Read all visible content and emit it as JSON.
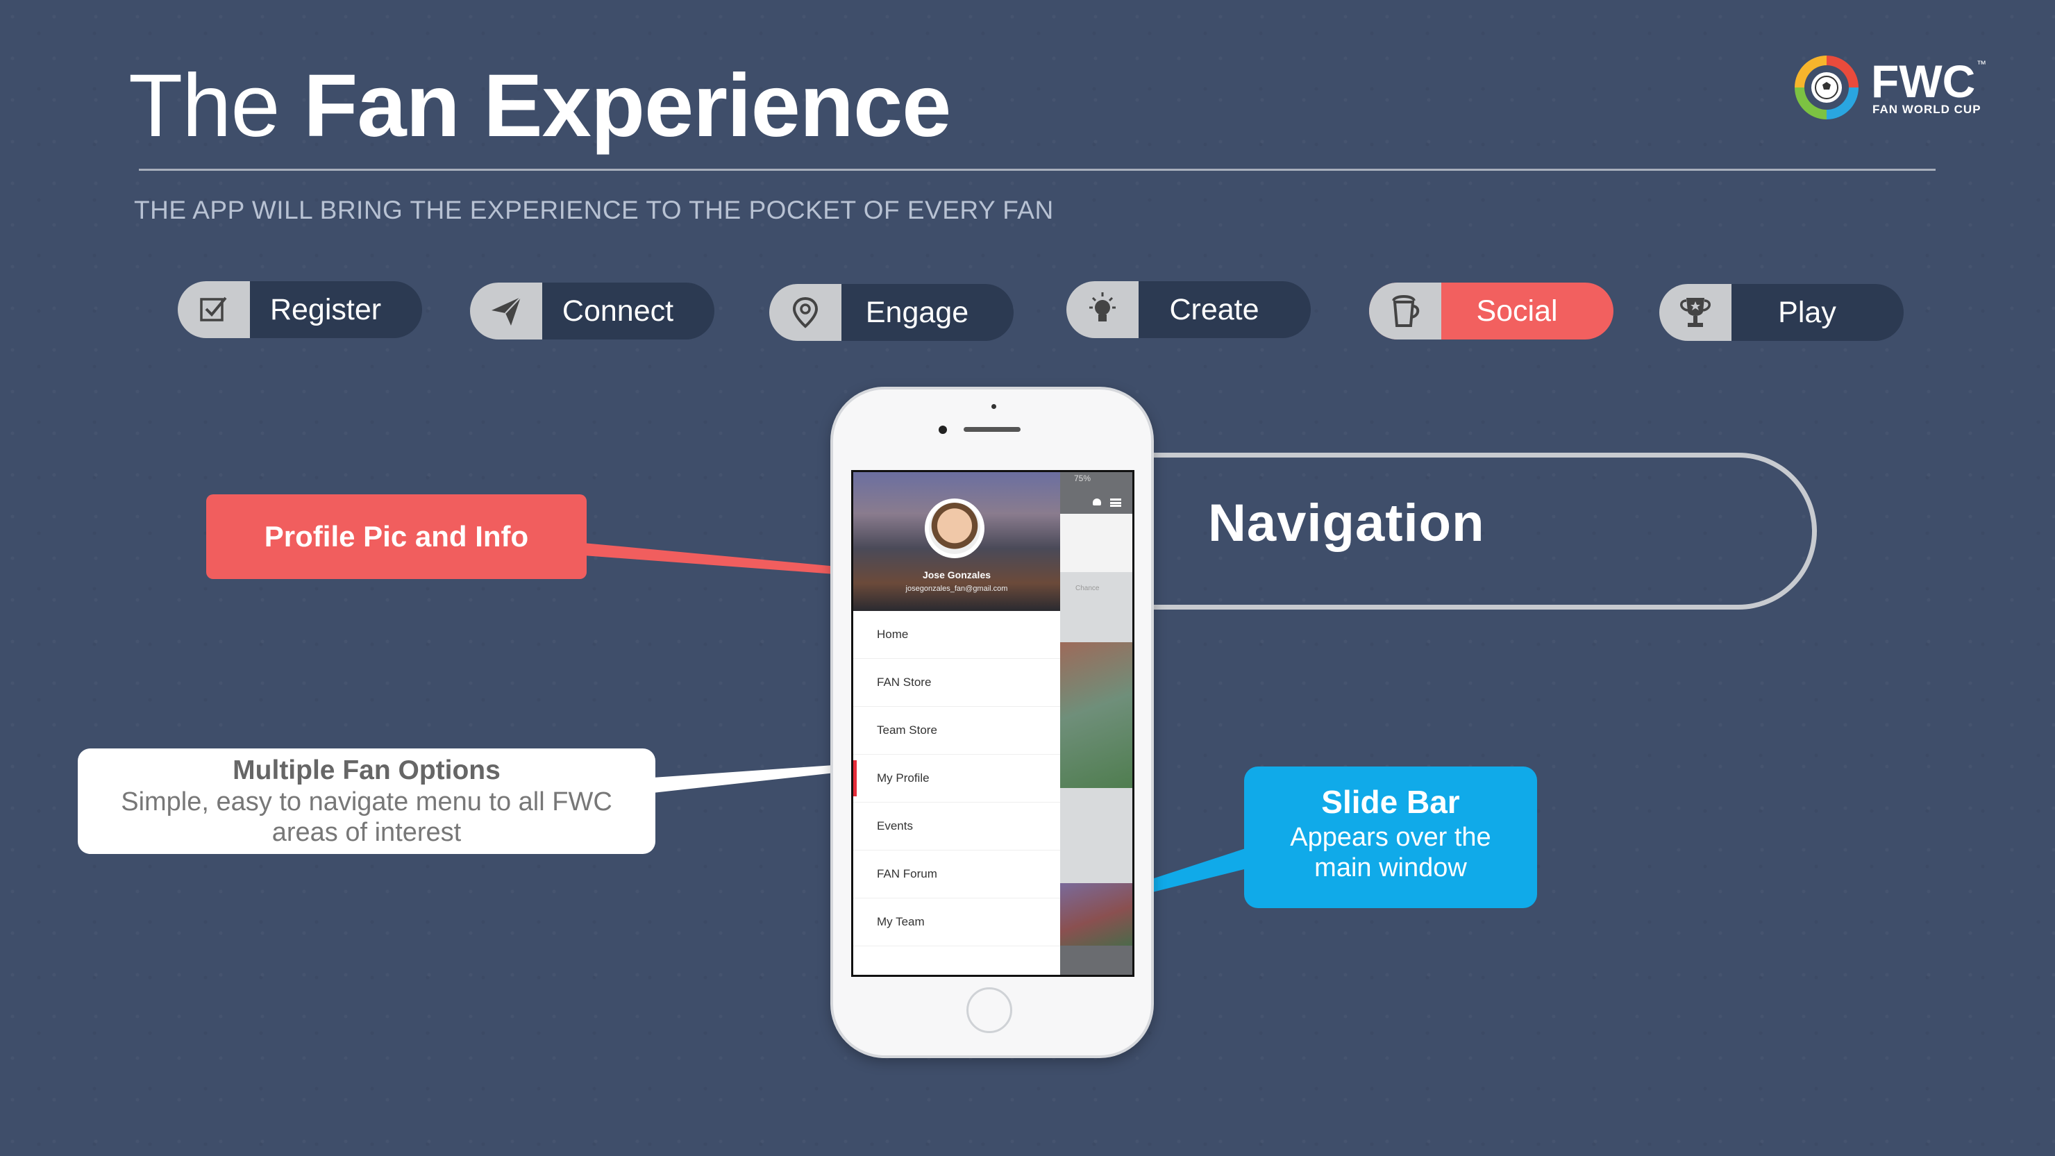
{
  "header": {
    "title_light": "The",
    "title_bold": "Fan Experience",
    "subtitle": "THE APP WILL BRING THE EXPERIENCE TO THE POCKET OF EVERY FAN"
  },
  "logo": {
    "text": "FWC",
    "tm": "™",
    "sub": "FAN WORLD CUP"
  },
  "pills": [
    {
      "label": "Register",
      "icon": "checkbox-icon",
      "active": false
    },
    {
      "label": "Connect",
      "icon": "paper-plane-icon",
      "active": false
    },
    {
      "label": "Engage",
      "icon": "location-pin-icon",
      "active": false
    },
    {
      "label": "Create",
      "icon": "lightbulb-icon",
      "active": false
    },
    {
      "label": "Social",
      "icon": "beer-mug-icon",
      "active": true
    },
    {
      "label": "Play",
      "icon": "trophy-icon",
      "active": false
    }
  ],
  "callouts": {
    "profile": "Profile Pic and Info",
    "navigation": "Navigation",
    "options_title": "Multiple Fan Options",
    "options_desc": "Simple, easy to navigate menu to all FWC areas of interest",
    "slide_title": "Slide Bar",
    "slide_desc": "Appears over the main window"
  },
  "phone": {
    "status": "75%",
    "user_name": "Jose Gonzales",
    "user_email": "josegonzales_fan@gmail.com",
    "app_text_1": "Chance",
    "menu": [
      {
        "label": "Home",
        "active": false
      },
      {
        "label": "FAN Store",
        "active": false
      },
      {
        "label": "Team Store",
        "active": false
      },
      {
        "label": "My Profile",
        "active": true
      },
      {
        "label": "Events",
        "active": false
      },
      {
        "label": "FAN Forum",
        "active": false
      },
      {
        "label": "My Team",
        "active": false
      }
    ]
  },
  "colors": {
    "background": "#3f4e6a",
    "accent_red": "#f15e5e",
    "accent_blue": "#10aae9",
    "pill_dark": "#2c3a52"
  }
}
